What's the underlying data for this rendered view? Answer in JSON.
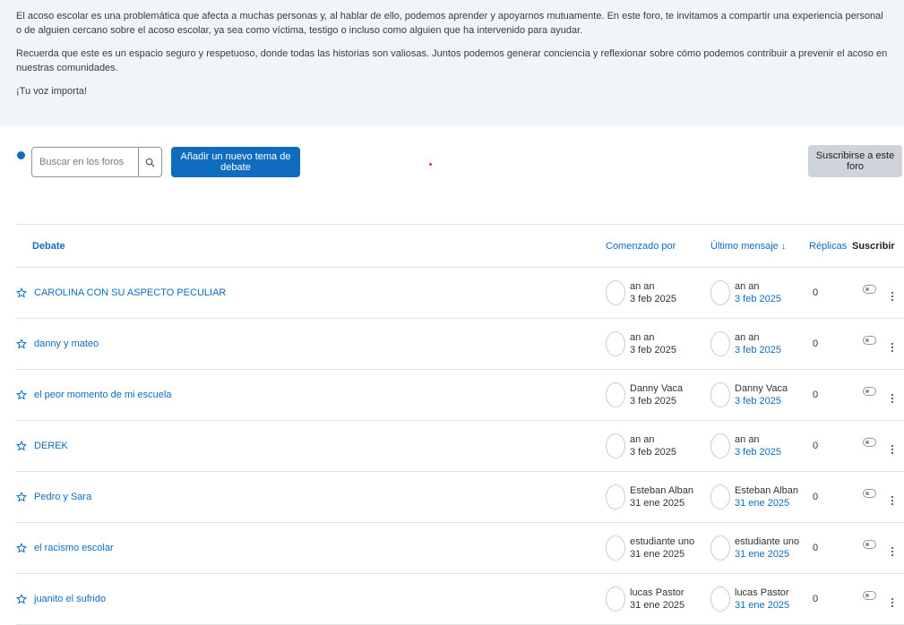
{
  "intro": {
    "p1": "El acoso escolar es una problemática que afecta a muchas personas y, al hablar de ello, podemos aprender y apoyarnos mutuamente. En este foro, te invitamos a compartir una experiencia personal o de alguien cercano sobre el acoso escolar, ya sea como víctima, testigo o incluso como alguien que ha intervenido para ayudar.",
    "p2": "Recuerda que este es un espacio seguro y respetuoso, donde todas las historias son valiosas. Juntos podemos generar conciencia y reflexionar sobre cómo podemos contribuir a prevenir el acoso en nuestras comunidades.",
    "p3": "¡Tu voz importa!"
  },
  "toolbar": {
    "search_placeholder": "Buscar en los foros",
    "add_label": "Añadir un nuevo tema de debate",
    "subscribe_label": "Suscribirse a este foro"
  },
  "table": {
    "headers": {
      "debate": "Debate",
      "started_by": "Comenzado por",
      "last_message": "Último mensaje ↓",
      "replies": "Réplicas",
      "subscribe": "Suscribir"
    },
    "rows": [
      {
        "title": "CAROLINA CON SU ASPECTO PECULIAR",
        "author": "an an",
        "author_date": "3 feb 2025",
        "last_author": "an an",
        "last_date": "3 feb 2025",
        "replies": "0"
      },
      {
        "title": "danny y mateo",
        "author": "an an",
        "author_date": "3 feb 2025",
        "last_author": "an an",
        "last_date": "3 feb 2025",
        "replies": "0"
      },
      {
        "title": "el peor momento de mi escuela",
        "author": "Danny Vaca",
        "author_date": "3 feb 2025",
        "last_author": "Danny Vaca",
        "last_date": "3 feb 2025",
        "replies": "0"
      },
      {
        "title": "DEREK",
        "author": "an an",
        "author_date": "3 feb 2025",
        "last_author": "an an",
        "last_date": "3 feb 2025",
        "replies": "0"
      },
      {
        "title": "Pedro y Sara",
        "author": "Esteban Alban",
        "author_date": "31 ene 2025",
        "last_author": "Esteban Alban",
        "last_date": "31 ene 2025",
        "replies": "0"
      },
      {
        "title": "el racismo escolar",
        "author": "estudiante uno",
        "author_date": "31 ene 2025",
        "last_author": "estudiante uno",
        "last_date": "31 ene 2025",
        "replies": "0"
      },
      {
        "title": "juanito el sufrido",
        "author": "lucas Pastor",
        "author_date": "31 ene 2025",
        "last_author": "lucas Pastor",
        "last_date": "31 ene 2025",
        "replies": "0"
      }
    ]
  },
  "colors": {
    "primary": "#0f6cbf",
    "intro_bg": "#f2f5f8",
    "secondary_btn": "#ced4da"
  }
}
